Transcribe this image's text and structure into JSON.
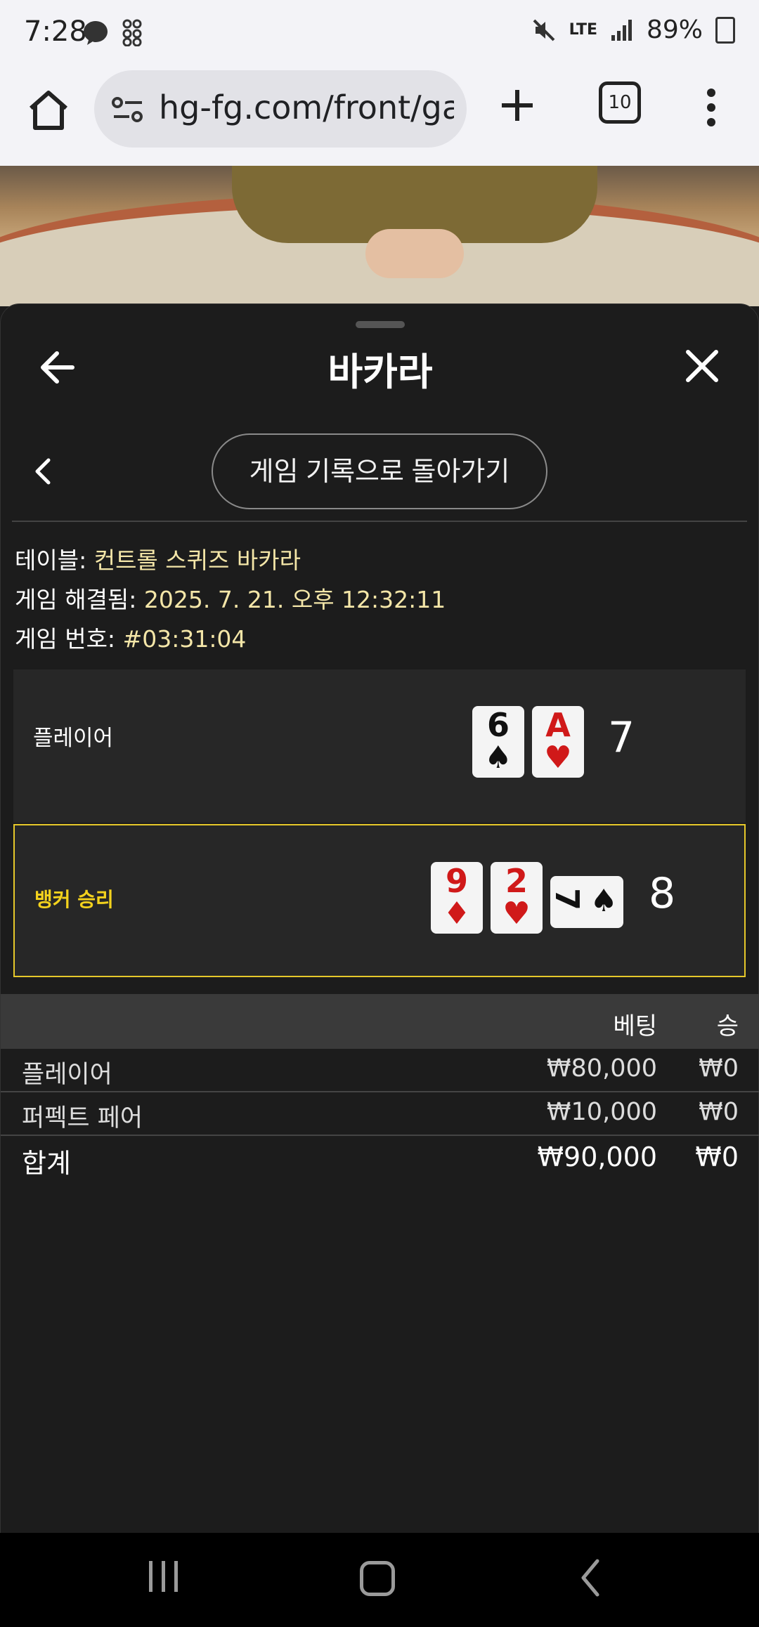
{
  "status_bar": {
    "time": "7:28",
    "left_icons": [
      "messenger-icon",
      "app-grid-icon"
    ],
    "right_icons": [
      "mute-icon",
      "lte-icon",
      "signal-icon"
    ],
    "lte": "LTE",
    "battery": "89%"
  },
  "browser": {
    "url": "hg-fg.com/front/gam",
    "tab_count": "10"
  },
  "sheet": {
    "title": "바카라",
    "back_to_history": "게임 기록으로 돌아가기"
  },
  "info": {
    "table_label": "테이블:",
    "table_value": "컨트롤 스퀴즈 바카라",
    "resolved_label": "게임 해결됨:",
    "resolved_value": "2025. 7. 21. 오후 12:32:11",
    "number_label": "게임 번호:",
    "number_value": "#03:31:04"
  },
  "hands": {
    "player": {
      "label": "플레이어",
      "cards": [
        {
          "rank": "6",
          "suit": "♠",
          "color": "black"
        },
        {
          "rank": "A",
          "suit": "♥",
          "color": "red"
        }
      ],
      "score": "7"
    },
    "banker": {
      "label": "뱅커 승리",
      "cards": [
        {
          "rank": "9",
          "suit": "♦",
          "color": "red"
        },
        {
          "rank": "2",
          "suit": "♥",
          "color": "red"
        },
        {
          "rank": "7",
          "suit": "♠",
          "color": "black",
          "sideways": true
        }
      ],
      "score": "8"
    }
  },
  "bets": {
    "header_bet": "베팅",
    "header_win": "승",
    "rows": [
      {
        "name": "플레이어",
        "amount": "₩80,000",
        "win": "₩0"
      },
      {
        "name": "퍼펙트 페어",
        "amount": "₩10,000",
        "win": "₩0"
      }
    ],
    "total": {
      "name": "합계",
      "amount": "₩90,000",
      "win": "₩0"
    }
  },
  "colors": {
    "accent_yellow": "#e6c82a",
    "info_value": "#f4e6a8",
    "sheet_bg": "#1c1c1c"
  }
}
